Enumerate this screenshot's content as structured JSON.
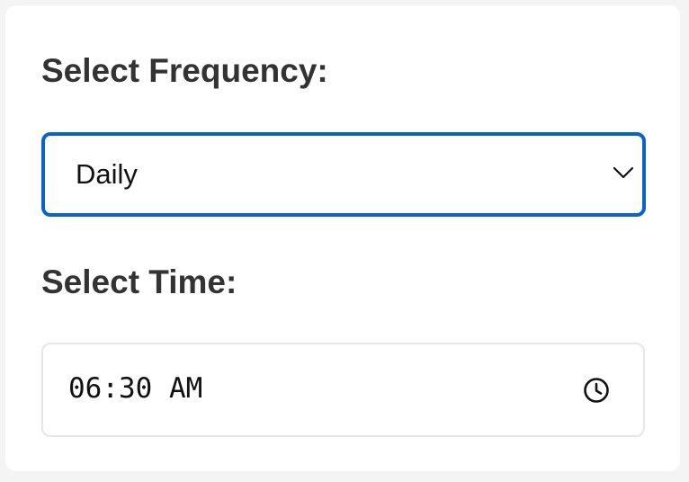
{
  "form": {
    "frequency_label": "Select Frequency:",
    "frequency_selected": "Daily",
    "time_label": "Select Time:",
    "time_value": "06:30 AM"
  },
  "icons": {
    "dropdown": "chevron-down-icon",
    "time_picker": "clock-icon"
  },
  "colors": {
    "focus_border": "#0a63c9",
    "label_text": "#333333",
    "input_border": "#e6e6e6",
    "background": "#f4f4f4"
  }
}
